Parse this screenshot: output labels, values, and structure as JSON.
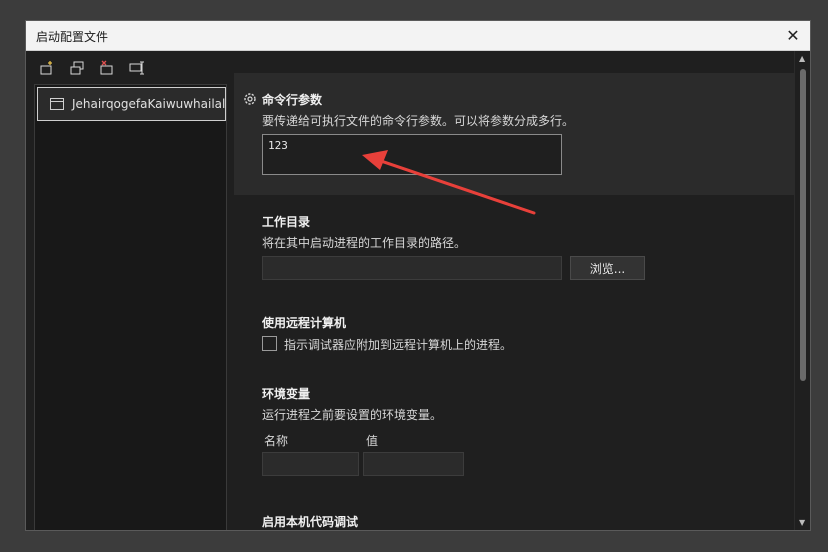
{
  "dialog": {
    "title": "启动配置文件",
    "close_glyph": "✕"
  },
  "toolbar": {
    "icons": [
      "new-profile-icon",
      "copy-profile-icon",
      "delete-profile-icon",
      "rename-profile-icon"
    ]
  },
  "profiles": [
    {
      "label": "JehairqogefaKaiwuwhailall"
    }
  ],
  "sections": {
    "args": {
      "title": "命令行参数",
      "desc": "要传递给可执行文件的命令行参数。可以将参数分成多行。",
      "value": "123"
    },
    "workdir": {
      "title": "工作目录",
      "desc": "将在其中启动进程的工作目录的路径。",
      "value": "",
      "browse_label": "浏览..."
    },
    "remote": {
      "title": "使用远程计算机",
      "checkbox_label": "指示调试器应附加到远程计算机上的进程。",
      "checked": false
    },
    "env": {
      "title": "环境变量",
      "desc": "运行进程之前要设置的环境变量。",
      "name_header": "名称",
      "value_header": "值",
      "name_value": "",
      "value_value": ""
    },
    "native": {
      "title": "启用本机代码调试"
    }
  },
  "colors": {
    "annotation_arrow": "#e8403a",
    "background": "#1f1f1f",
    "highlight": "#2b2b2b"
  }
}
